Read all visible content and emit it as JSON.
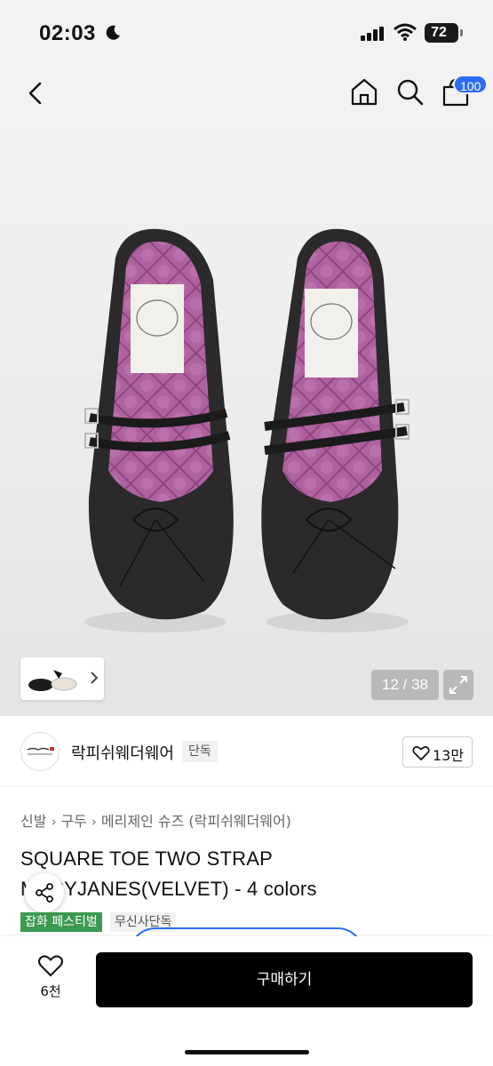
{
  "status_bar": {
    "time": "02:03",
    "battery": "72"
  },
  "header": {
    "cart_badge": "100"
  },
  "gallery": {
    "counter": "12 / 38"
  },
  "brand": {
    "name": "락피쉬웨더웨어",
    "tag": "단독",
    "likes": "13만"
  },
  "breadcrumb": [
    "신발",
    "구두",
    "메리제인 슈즈 (락피쉬웨더웨어)"
  ],
  "product": {
    "title": "SQUARE TOE TWO STRAP MARYJANES(VELVET) - 4 colors",
    "badges": [
      "잡화 페스티벌",
      "무신사단독"
    ]
  },
  "bottom_bar": {
    "wish_count": "6천",
    "buy_label": "구매하기"
  },
  "colors": {
    "accent_blue": "#2d6cf0",
    "festival_green": "#3b9a52",
    "lining_purple": "#b0629f"
  }
}
